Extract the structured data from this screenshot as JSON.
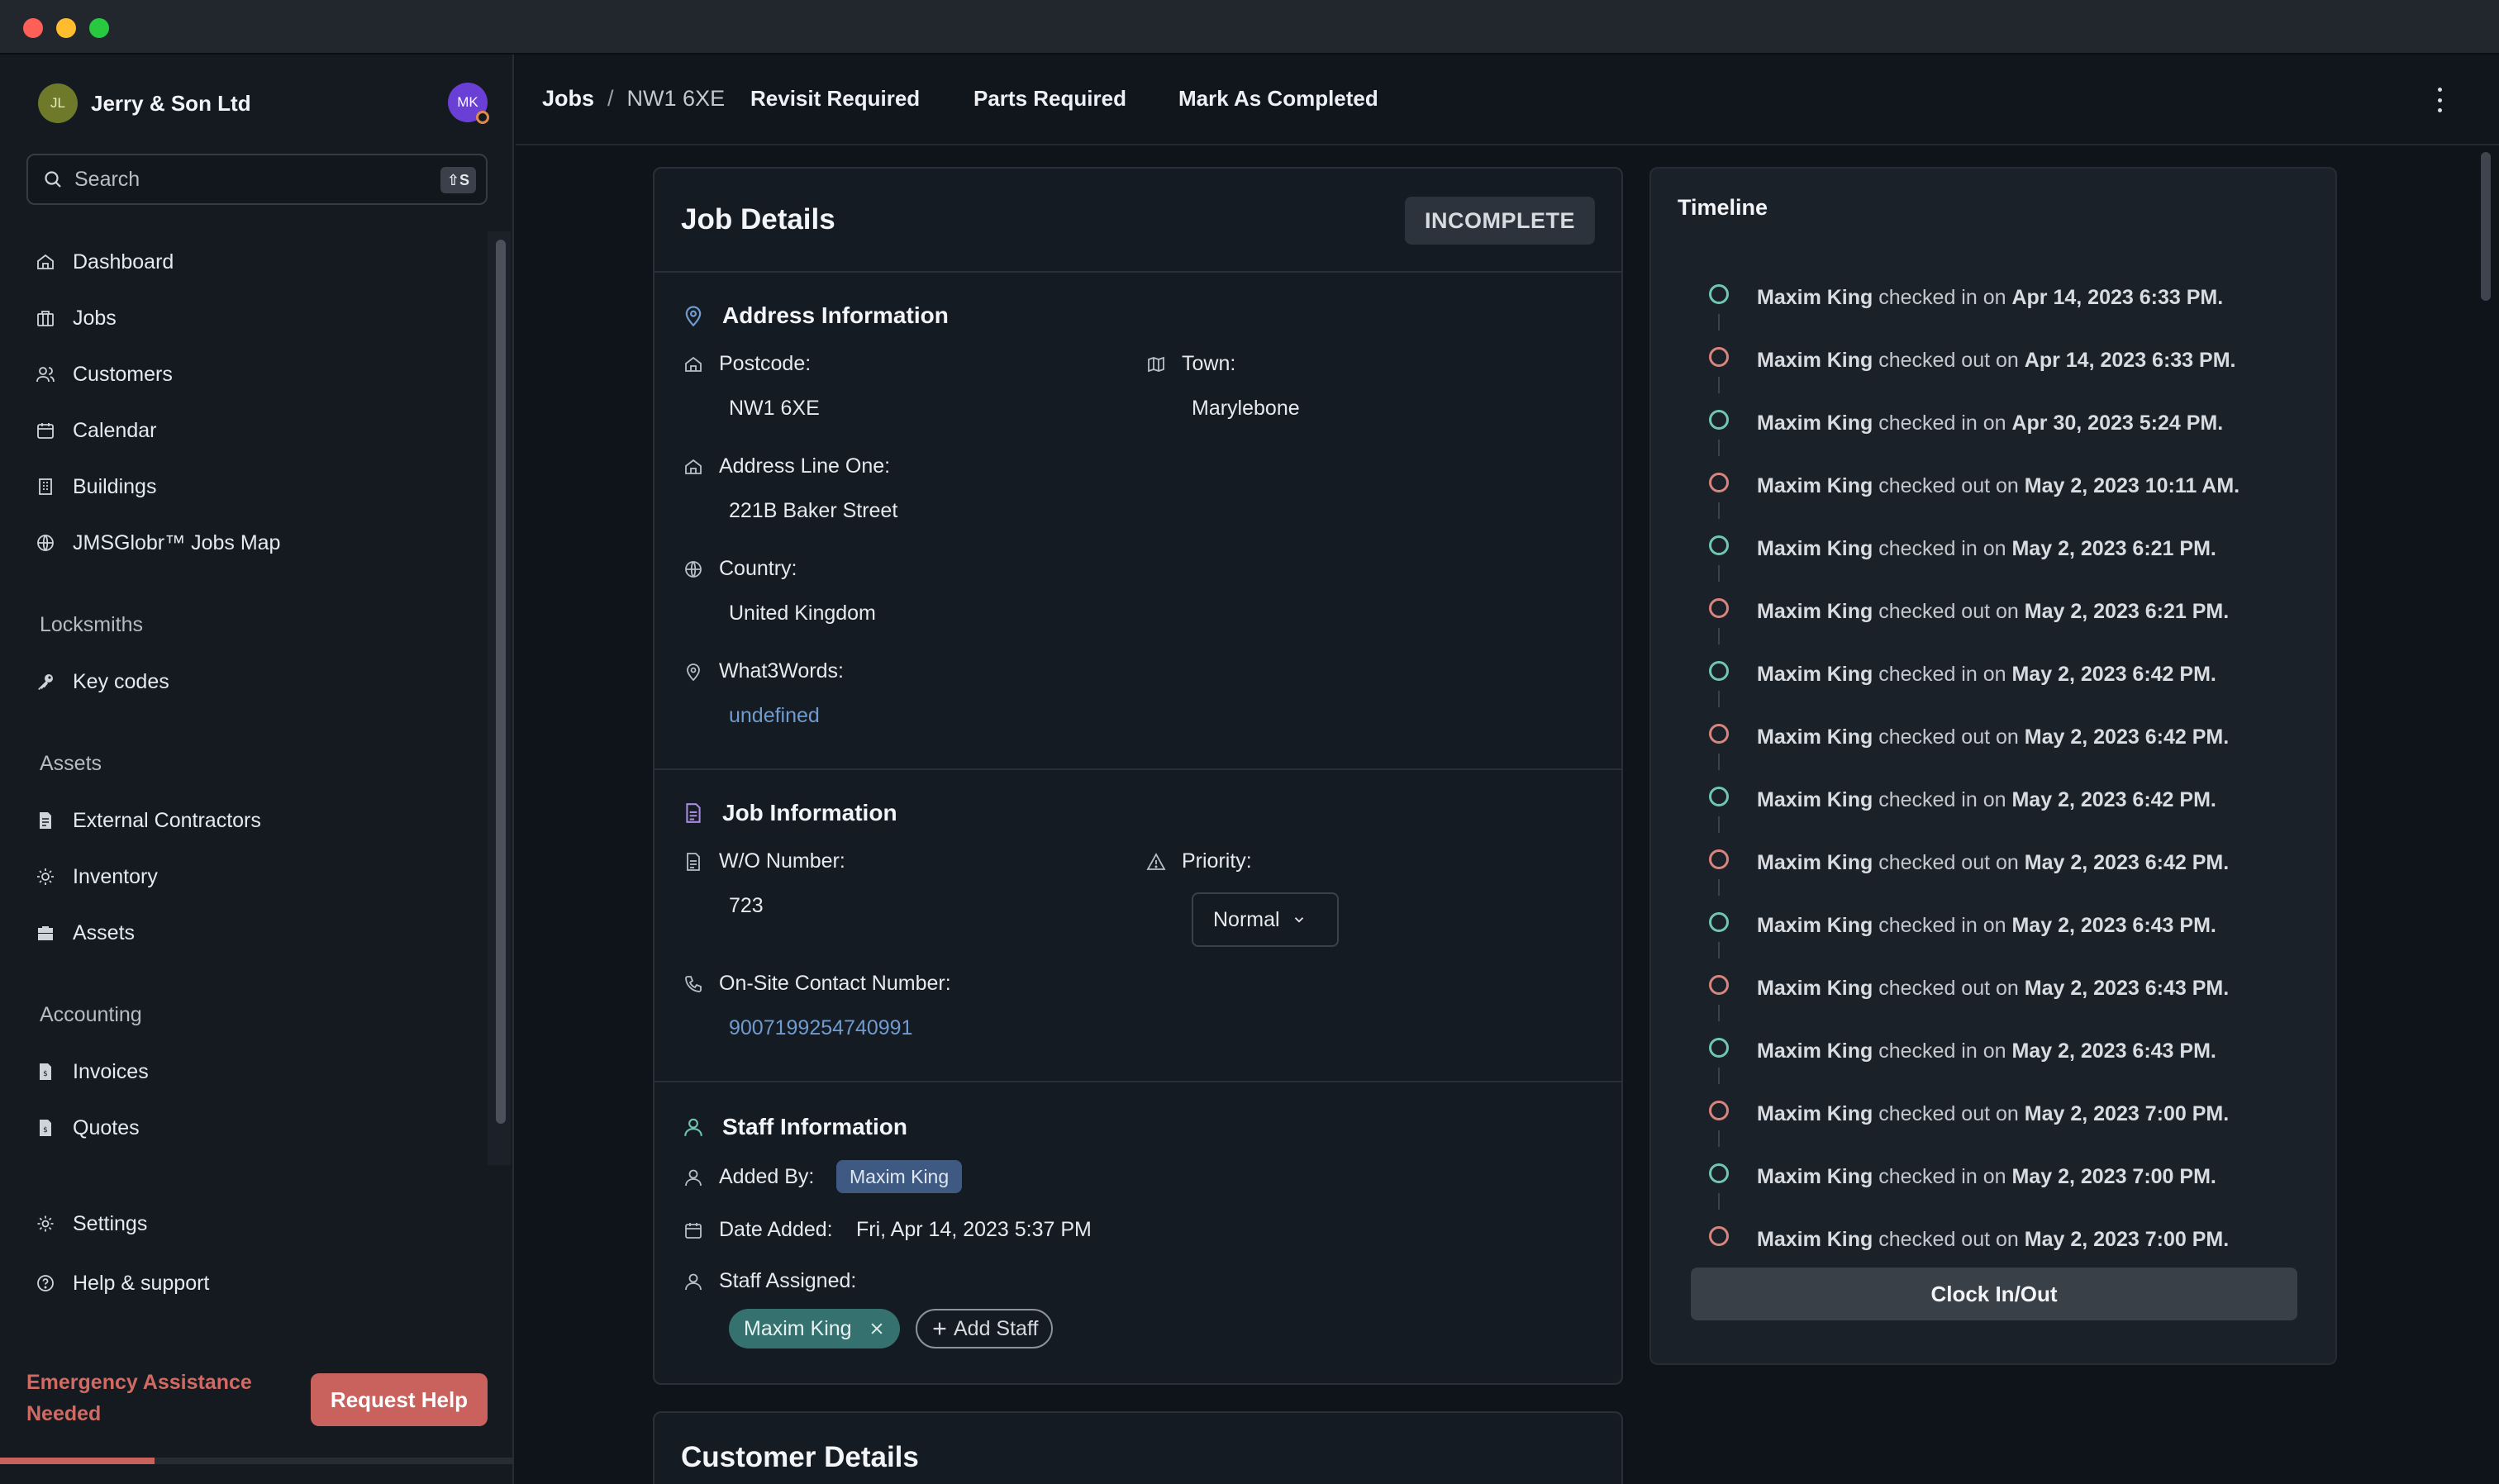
{
  "org": {
    "initials": "JL",
    "name": "Jerry & Son Ltd",
    "user_initials": "MK"
  },
  "search": {
    "placeholder": "Search",
    "shortcut": "⇧S"
  },
  "nav": {
    "dashboard": "Dashboard",
    "jobs": "Jobs",
    "customers": "Customers",
    "calendar": "Calendar",
    "buildings": "Buildings",
    "jobs_map": "JMSGlobr™ Jobs Map",
    "locksmiths_heading": "Locksmiths",
    "key_codes": "Key codes",
    "assets_heading": "Assets",
    "external_contractors": "External Contractors",
    "inventory": "Inventory",
    "assets": "Assets",
    "accounting_heading": "Accounting",
    "invoices": "Invoices",
    "quotes": "Quotes",
    "settings": "Settings",
    "help": "Help & support"
  },
  "emergency": {
    "text": "Emergency Assistance Needed",
    "button": "Request Help",
    "progress": 0.3
  },
  "topbar": {
    "crumb_root": "Jobs",
    "crumb_sep": "/",
    "crumb_current": "NW1 6XE",
    "revisit": "Revisit Required",
    "parts": "Parts Required",
    "complete": "Mark As Completed"
  },
  "job": {
    "title": "Job Details",
    "status": "INCOMPLETE",
    "address": {
      "heading": "Address Information",
      "postcode_label": "Postcode:",
      "postcode": "NW1 6XE",
      "town_label": "Town:",
      "town": "Marylebone",
      "line1_label": "Address Line One:",
      "line1": "221B Baker Street",
      "country_label": "Country:",
      "country": "United Kingdom",
      "w3w_label": "What3Words:",
      "w3w": "undefined"
    },
    "info": {
      "heading": "Job Information",
      "wo_label": "W/O Number:",
      "wo": "723",
      "priority_label": "Priority:",
      "priority": "Normal",
      "contact_label": "On-Site Contact Number:",
      "contact": "9007199254740991"
    },
    "staff": {
      "heading": "Staff Information",
      "added_by_label": "Added By:",
      "added_by": "Maxim King",
      "date_label": "Date Added:",
      "date": "Fri, Apr 14, 2023 5:37 PM",
      "assigned_label": "Staff Assigned:",
      "assigned": "Maxim King",
      "add_staff": "Add Staff"
    }
  },
  "customer": {
    "title": "Customer Details"
  },
  "timeline": {
    "title": "Timeline",
    "button": "Clock In/Out",
    "colors": {
      "in": "#6fc6b3",
      "out": "#d9857f"
    },
    "events": [
      {
        "name": "Maxim King",
        "action": "checked in on",
        "date": "Apr 14, 2023 6:33 PM.",
        "type": "in"
      },
      {
        "name": "Maxim King",
        "action": "checked out on",
        "date": "Apr 14, 2023 6:33 PM.",
        "type": "out"
      },
      {
        "name": "Maxim King",
        "action": "checked in on",
        "date": "Apr 30, 2023 5:24 PM.",
        "type": "in"
      },
      {
        "name": "Maxim King",
        "action": "checked out on",
        "date": "May 2, 2023 10:11 AM.",
        "type": "out"
      },
      {
        "name": "Maxim King",
        "action": "checked in on",
        "date": "May 2, 2023 6:21 PM.",
        "type": "in"
      },
      {
        "name": "Maxim King",
        "action": "checked out on",
        "date": "May 2, 2023 6:21 PM.",
        "type": "out"
      },
      {
        "name": "Maxim King",
        "action": "checked in on",
        "date": "May 2, 2023 6:42 PM.",
        "type": "in"
      },
      {
        "name": "Maxim King",
        "action": "checked out on",
        "date": "May 2, 2023 6:42 PM.",
        "type": "out"
      },
      {
        "name": "Maxim King",
        "action": "checked in on",
        "date": "May 2, 2023 6:42 PM.",
        "type": "in"
      },
      {
        "name": "Maxim King",
        "action": "checked out on",
        "date": "May 2, 2023 6:42 PM.",
        "type": "out"
      },
      {
        "name": "Maxim King",
        "action": "checked in on",
        "date": "May 2, 2023 6:43 PM.",
        "type": "in"
      },
      {
        "name": "Maxim King",
        "action": "checked out on",
        "date": "May 2, 2023 6:43 PM.",
        "type": "out"
      },
      {
        "name": "Maxim King",
        "action": "checked in on",
        "date": "May 2, 2023 6:43 PM.",
        "type": "in"
      },
      {
        "name": "Maxim King",
        "action": "checked out on",
        "date": "May 2, 2023 7:00 PM.",
        "type": "out"
      },
      {
        "name": "Maxim King",
        "action": "checked in on",
        "date": "May 2, 2023 7:00 PM.",
        "type": "in"
      },
      {
        "name": "Maxim King",
        "action": "checked out on",
        "date": "May 2, 2023 7:00 PM.",
        "type": "out"
      }
    ]
  }
}
